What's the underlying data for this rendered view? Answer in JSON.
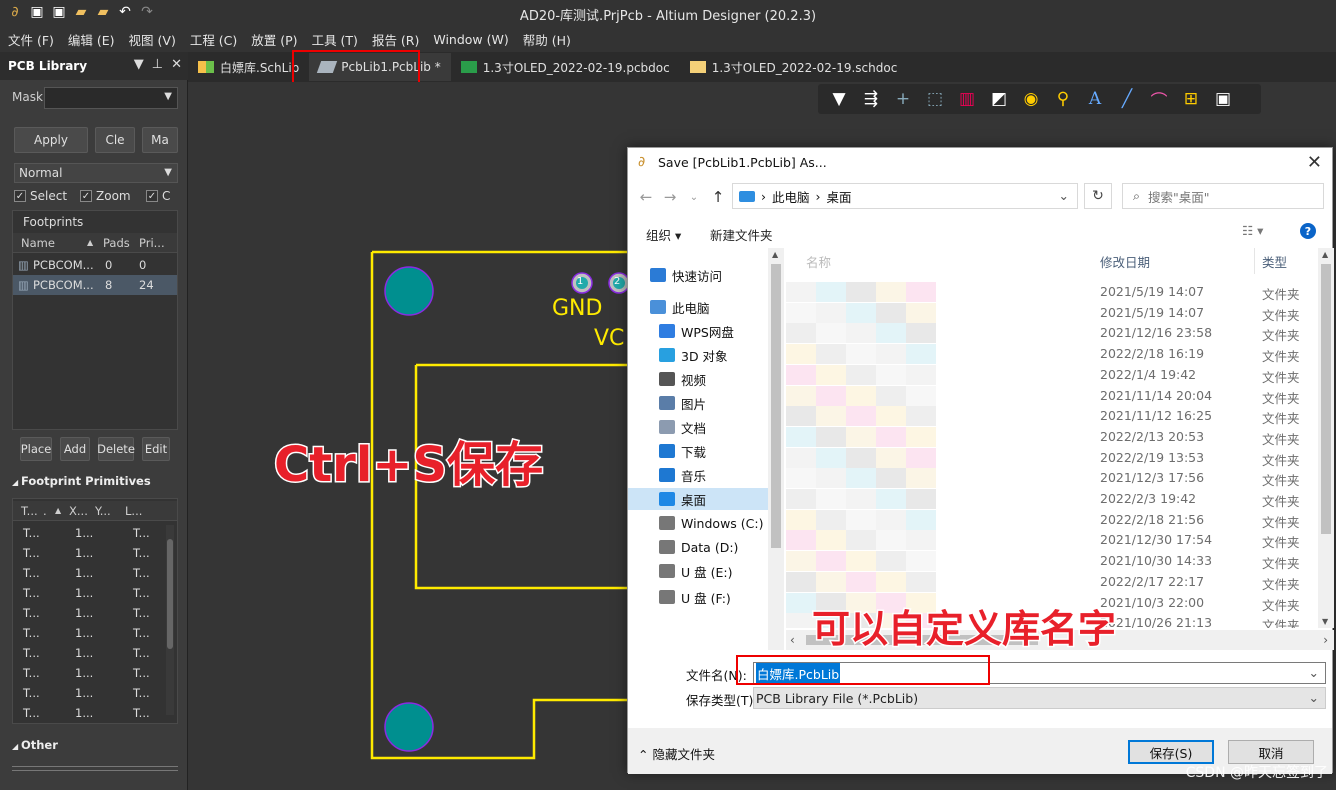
{
  "window": {
    "title": "AD20-库测试.PrjPcb - Altium Designer (20.2.3)"
  },
  "menu": [
    "文件 (F)",
    "编辑 (E)",
    "视图 (V)",
    "工程 (C)",
    "放置 (P)",
    "工具 (T)",
    "报告 (R)",
    "Window (W)",
    "帮助 (H)"
  ],
  "panel": {
    "title": "PCB Library",
    "mask_label": "Mask",
    "apply": "Apply",
    "clear": "Cle",
    "magnify": "Ma",
    "mode": "Normal",
    "chk_select": "Select",
    "chk_zoom": "Zoom",
    "chk_c": "C",
    "footprints_label": "Footprints",
    "fp_cols": [
      "Name",
      "Pads",
      "Pri..."
    ],
    "fp_rows": [
      {
        "name": "PCBCOM...",
        "pads": "0",
        "pri": "0"
      },
      {
        "name": "PCBCOM...",
        "pads": "8",
        "pri": "24"
      }
    ],
    "btn_place": "Place",
    "btn_add": "Add",
    "btn_delete": "Delete",
    "btn_edit": "Edit",
    "primitives_label": "Footprint Primitives",
    "prim_cols": [
      "T...",
      ".",
      "X...",
      "Y...",
      "L..."
    ],
    "prim_rows": [
      [
        "T...",
        "1...",
        "T..."
      ],
      [
        "T...",
        "1...",
        "T..."
      ],
      [
        "T...",
        "1...",
        "T..."
      ],
      [
        "T...",
        "1...",
        "T..."
      ],
      [
        "T...",
        "1...",
        "T..."
      ],
      [
        "T...",
        "1...",
        "T..."
      ],
      [
        "T...",
        "1...",
        "T..."
      ],
      [
        "T...",
        "1...",
        "T..."
      ],
      [
        "T...",
        "1...",
        "T..."
      ],
      [
        "T...",
        "1...",
        "T..."
      ]
    ],
    "other_label": "Other"
  },
  "tabs": [
    {
      "label": "白嫖库.SchLib"
    },
    {
      "label": "PcbLib1.PcbLib *"
    },
    {
      "label": "1.3寸OLED_2022-02-19.pcbdoc"
    },
    {
      "label": "1.3寸OLED_2022-02-19.schdoc"
    }
  ],
  "canvas": {
    "pad1": "1",
    "pad2": "2",
    "gnd": "GND",
    "vc": "VC",
    "annotation_save": "Ctrl+S保存",
    "annotation_name": "可以自定义库名字"
  },
  "dialog": {
    "title": "Save [PcbLib1.PcbLib] As...",
    "path": [
      "此电脑",
      "桌面"
    ],
    "search_placeholder": "搜索\"桌面\"",
    "organize": "组织",
    "new_folder": "新建文件夹",
    "col_name": "名称",
    "col_date": "修改日期",
    "col_type": "类型",
    "nav": [
      {
        "label": "快速访问",
        "icon": "star-icon"
      },
      {
        "label": "此电脑",
        "icon": "computer-icon"
      },
      {
        "label": "WPS网盘",
        "icon": "cloud-icon"
      },
      {
        "label": "3D 对象",
        "icon": "cube-icon"
      },
      {
        "label": "视频",
        "icon": "video-icon"
      },
      {
        "label": "图片",
        "icon": "picture-icon"
      },
      {
        "label": "文档",
        "icon": "document-icon"
      },
      {
        "label": "下载",
        "icon": "download-icon"
      },
      {
        "label": "音乐",
        "icon": "music-icon"
      },
      {
        "label": "桌面",
        "icon": "desktop-icon"
      },
      {
        "label": "Windows (C:)",
        "icon": "drive-icon"
      },
      {
        "label": "Data (D:)",
        "icon": "drive-icon"
      },
      {
        "label": "U 盘 (E:)",
        "icon": "usb-drive-icon"
      },
      {
        "label": "U 盘 (F:)",
        "icon": "usb-drive-icon"
      }
    ],
    "files": [
      {
        "date": "2021/5/19 14:07",
        "type": "文件夹"
      },
      {
        "date": "2021/5/19 14:07",
        "type": "文件夹"
      },
      {
        "date": "2021/12/16 23:58",
        "type": "文件夹"
      },
      {
        "date": "2022/2/18 16:19",
        "type": "文件夹"
      },
      {
        "date": "2022/1/4 19:42",
        "type": "文件夹"
      },
      {
        "date": "2021/11/14 20:04",
        "type": "文件夹"
      },
      {
        "date": "2021/11/12 16:25",
        "type": "文件夹"
      },
      {
        "date": "2022/2/13 20:53",
        "type": "文件夹"
      },
      {
        "date": "2022/2/19 13:53",
        "type": "文件夹"
      },
      {
        "date": "2021/12/3 17:56",
        "type": "文件夹"
      },
      {
        "date": "2022/2/3 19:42",
        "type": "文件夹"
      },
      {
        "date": "2022/2/18 21:56",
        "type": "文件夹"
      },
      {
        "date": "2021/12/30 17:54",
        "type": "文件夹"
      },
      {
        "date": "2021/10/30 14:33",
        "type": "文件夹"
      },
      {
        "date": "2022/2/17 22:17",
        "type": "文件夹"
      },
      {
        "date": "2021/10/3 22:00",
        "type": "文件夹"
      },
      {
        "date": "2021/10/26 21:13",
        "type": "文件夹"
      }
    ],
    "filename_label": "文件名(N):",
    "filename_value": "白嫖库.PcbLib",
    "filetype_label": "保存类型(T):",
    "filetype_value": "PCB Library File (*.PcbLib)",
    "hide_folders": "隐藏文件夹",
    "save": "保存(S)",
    "cancel": "取消"
  },
  "watermark": "CSDN @昨天忘签到了"
}
